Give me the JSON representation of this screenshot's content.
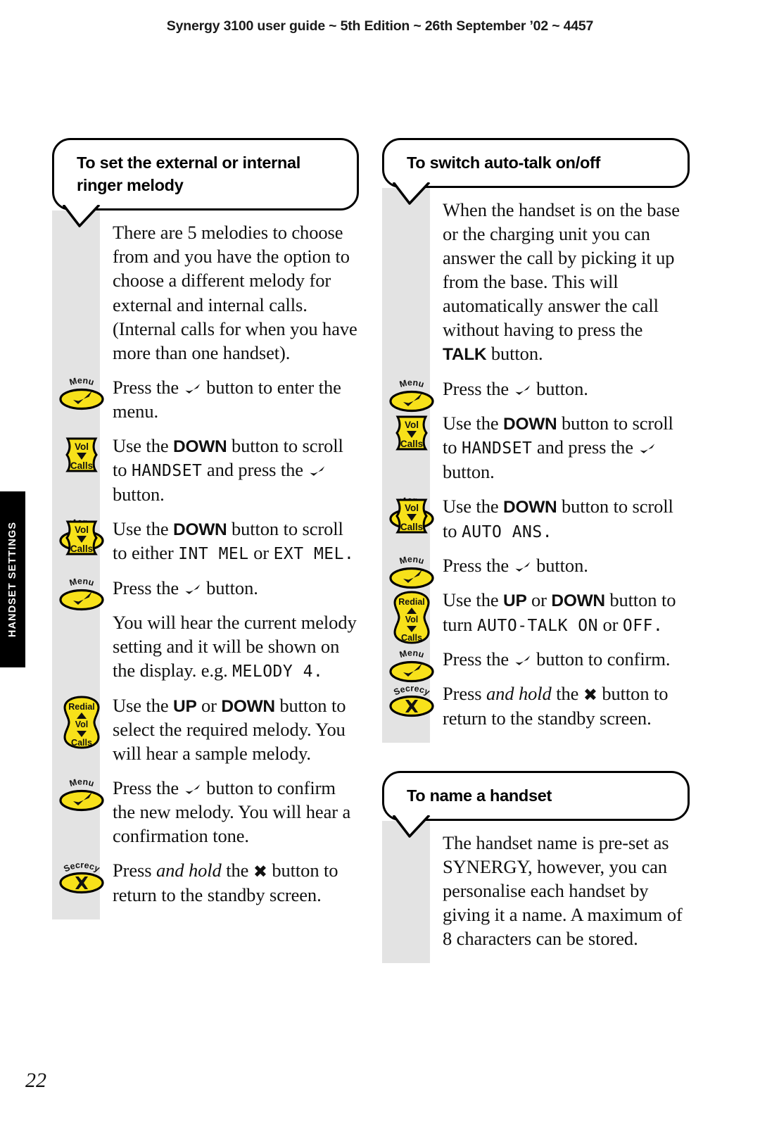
{
  "header": {
    "running_head": "Synergy 3100 user guide ~ 5th Edition ~ 26th September ’02 ~ 4457"
  },
  "side_tab": {
    "label": "HANDSET SETTINGS"
  },
  "page_number": "22",
  "icons": {
    "menu_label": "Menu",
    "vol_label": "Vol",
    "calls_label": "Calls",
    "redial_label": "Redial",
    "secrecy_label": "Secrecy",
    "check_icon": "check-tick-icon",
    "cross_icon": "cross-x-icon",
    "key_yellow": "#F7E11A",
    "key_outline": "#000000",
    "rail_grey": "#E3E3E3"
  },
  "sections": [
    {
      "id": "ringer-melody",
      "title": "To set the external or internal ringer melody",
      "steps": [
        {
          "key": null,
          "runs": [
            {
              "t": "There are 5 melodies to choose from and you have the option to choose a different melody for external and internal calls. (Internal calls for when you have more than one handset)."
            }
          ]
        },
        {
          "key": "menu",
          "runs": [
            {
              "t": "Press the "
            },
            {
              "t": "✔",
              "s": "check"
            },
            {
              "t": " button to enter the menu."
            }
          ]
        },
        {
          "key": "voldown",
          "runs": [
            {
              "t": "Use the "
            },
            {
              "t": "DOWN",
              "s": "bold"
            },
            {
              "t": " button to scroll to "
            },
            {
              "t": "HANDSET",
              "s": "lcd"
            },
            {
              "t": " and press the "
            },
            {
              "t": "✔",
              "s": "check"
            },
            {
              "t": " button."
            }
          ]
        },
        {
          "key": "menu",
          "runs": []
        },
        {
          "key": "voldown",
          "runs": [
            {
              "t": "Use the "
            },
            {
              "t": "DOWN",
              "s": "bold"
            },
            {
              "t": " button to scroll to either "
            },
            {
              "t": "INT MEL",
              "s": "lcd"
            },
            {
              "t": " or "
            },
            {
              "t": "EXT MEL.",
              "s": "lcd"
            }
          ]
        },
        {
          "key": "menu",
          "runs": [
            {
              "t": "Press the "
            },
            {
              "t": "✔",
              "s": "check"
            },
            {
              "t": " button."
            }
          ]
        },
        {
          "key": null,
          "runs": [
            {
              "t": "You will hear the current melody setting and it will be shown on the display. e.g. "
            },
            {
              "t": "MELODY 4.",
              "s": "lcd"
            }
          ]
        },
        {
          "key": "updown",
          "runs": [
            {
              "t": "Use the "
            },
            {
              "t": "UP",
              "s": "bold"
            },
            {
              "t": " or "
            },
            {
              "t": "DOWN",
              "s": "bold"
            },
            {
              "t": " button to select the required melody. You will hear a sample melody."
            }
          ]
        },
        {
          "key": "menu",
          "runs": [
            {
              "t": "Press the "
            },
            {
              "t": "✔",
              "s": "check"
            },
            {
              "t": " button to confirm the new melody. You will hear a confirmation tone."
            }
          ]
        },
        {
          "key": "secrecy",
          "runs": [
            {
              "t": "Press "
            },
            {
              "t": "and hold",
              "s": "italic"
            },
            {
              "t": " the "
            },
            {
              "t": "✖",
              "s": "cross"
            },
            {
              "t": " button to return to the standby screen."
            }
          ]
        }
      ]
    },
    {
      "id": "auto-talk",
      "title": "To switch auto-talk on/off",
      "steps": [
        {
          "key": null,
          "runs": [
            {
              "t": "When the handset is on the base or the charging unit you can answer the call by picking it up from the base. This will automatically answer the call without having to press the "
            },
            {
              "t": "TALK",
              "s": "bold"
            },
            {
              "t": " button."
            }
          ]
        },
        {
          "key": "menu",
          "runs": [
            {
              "t": "Press the "
            },
            {
              "t": "✔",
              "s": "check"
            },
            {
              "t": " button."
            }
          ]
        },
        {
          "key": "voldown",
          "runs": [
            {
              "t": "Use the "
            },
            {
              "t": "DOWN",
              "s": "bold"
            },
            {
              "t": " button to scroll to "
            },
            {
              "t": "HANDSET",
              "s": "lcd"
            },
            {
              "t": " and press the "
            },
            {
              "t": "✔",
              "s": "check"
            },
            {
              "t": " button."
            }
          ]
        },
        {
          "key": "menu",
          "runs": []
        },
        {
          "key": "voldown",
          "runs": [
            {
              "t": "Use the "
            },
            {
              "t": "DOWN",
              "s": "bold"
            },
            {
              "t": " button to scroll to "
            },
            {
              "t": "AUTO ANS.",
              "s": "lcd"
            }
          ]
        },
        {
          "key": "menu",
          "runs": [
            {
              "t": "Press the "
            },
            {
              "t": "✔",
              "s": "check"
            },
            {
              "t": " button."
            }
          ]
        },
        {
          "key": "updown",
          "runs": [
            {
              "t": "Use the "
            },
            {
              "t": "UP",
              "s": "bold"
            },
            {
              "t": " or "
            },
            {
              "t": "DOWN",
              "s": "bold"
            },
            {
              "t": " button to turn "
            },
            {
              "t": "AUTO-TALK ON",
              "s": "lcd"
            },
            {
              "t": " or "
            },
            {
              "t": "OFF.",
              "s": "lcd"
            }
          ]
        },
        {
          "key": "menu",
          "runs": [
            {
              "t": "Press the "
            },
            {
              "t": "✔",
              "s": "check"
            },
            {
              "t": " button to confirm."
            }
          ]
        },
        {
          "key": "secrecy",
          "runs": [
            {
              "t": "Press "
            },
            {
              "t": "and hold",
              "s": "italic"
            },
            {
              "t": " the "
            },
            {
              "t": "✖",
              "s": "cross"
            },
            {
              "t": " button to return to the standby screen."
            }
          ]
        }
      ]
    },
    {
      "id": "name-handset",
      "title": "To name a handset",
      "steps": [
        {
          "key": null,
          "runs": [
            {
              "t": "The handset name is pre-set as SYNERGY, however, you can personalise each handset by giving it a name. A maximum of 8 characters can be stored."
            }
          ]
        }
      ]
    }
  ]
}
